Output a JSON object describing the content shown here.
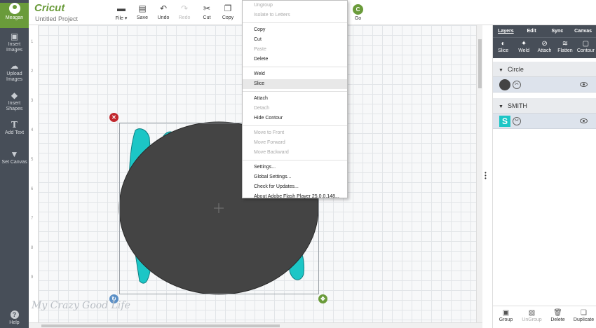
{
  "app": {
    "logo": "Cricut",
    "project_title": "Untitled Project",
    "user_label": "Meagan"
  },
  "sidebar": [
    {
      "label": "Insert Images",
      "icon": "image-icon"
    },
    {
      "label": "Upload Images",
      "icon": "upload-icon"
    },
    {
      "label": "Insert Shapes",
      "icon": "shapes-icon"
    },
    {
      "label": "Add Text",
      "icon": "text-icon"
    },
    {
      "label": "Set Canvas",
      "icon": "shirt-icon"
    }
  ],
  "sidebar_help": "Help",
  "toolbar": {
    "file": "File",
    "save": "Save",
    "undo": "Undo",
    "redo": "Redo",
    "cut": "Cut",
    "copy": "Copy",
    "go": "Go",
    "go_glyph": "C"
  },
  "ruler": [
    "1",
    "2",
    "3",
    "4",
    "5",
    "6",
    "7",
    "8",
    "9"
  ],
  "context_menu": [
    {
      "label": "Ungroup",
      "disabled": true
    },
    {
      "label": "Isolate to Letters",
      "disabled": true
    },
    {
      "sep": true
    },
    {
      "label": "Copy",
      "disabled": false
    },
    {
      "label": "Cut",
      "disabled": false
    },
    {
      "label": "Paste",
      "disabled": true
    },
    {
      "label": "Delete",
      "disabled": false
    },
    {
      "sep": true
    },
    {
      "label": "Weld",
      "disabled": false
    },
    {
      "label": "Slice",
      "disabled": false,
      "highlighted": true
    },
    {
      "sep": true
    },
    {
      "label": "Attach",
      "disabled": false
    },
    {
      "label": "Detach",
      "disabled": true
    },
    {
      "label": "Hide Contour",
      "disabled": false
    },
    {
      "sep": true
    },
    {
      "label": "Move to Front",
      "disabled": true
    },
    {
      "label": "Move Forward",
      "disabled": true
    },
    {
      "label": "Move Backward",
      "disabled": true
    },
    {
      "sep": true
    },
    {
      "label": "Settings...",
      "disabled": false
    },
    {
      "label": "Global Settings...",
      "disabled": false
    },
    {
      "label": "Check for Updates...",
      "disabled": false
    },
    {
      "label": "About Adobe Flash Player 25.0.0.148...",
      "disabled": false
    }
  ],
  "panel": {
    "tabs": [
      "Layers",
      "Edit",
      "Sync",
      "Canvas"
    ],
    "tools": [
      "Slice",
      "Weld",
      "Attach",
      "Flatten",
      "Contour"
    ],
    "groups": [
      {
        "name": "Circle"
      },
      {
        "name": "SMITH",
        "thumb_letter": "S"
      }
    ],
    "bottom": [
      {
        "label": "Group",
        "disabled": false
      },
      {
        "label": "UnGroup",
        "disabled": true
      },
      {
        "label": "Delete",
        "disabled": false
      },
      {
        "label": "Duplicate",
        "disabled": false
      }
    ]
  },
  "watermark": "My Crazy Good Life",
  "colors": {
    "accent": "#6a9b3a",
    "sidebar": "#474e58",
    "circle": "#444444",
    "text_shape": "#1cc6c6",
    "delete_handle": "#c1272d"
  }
}
